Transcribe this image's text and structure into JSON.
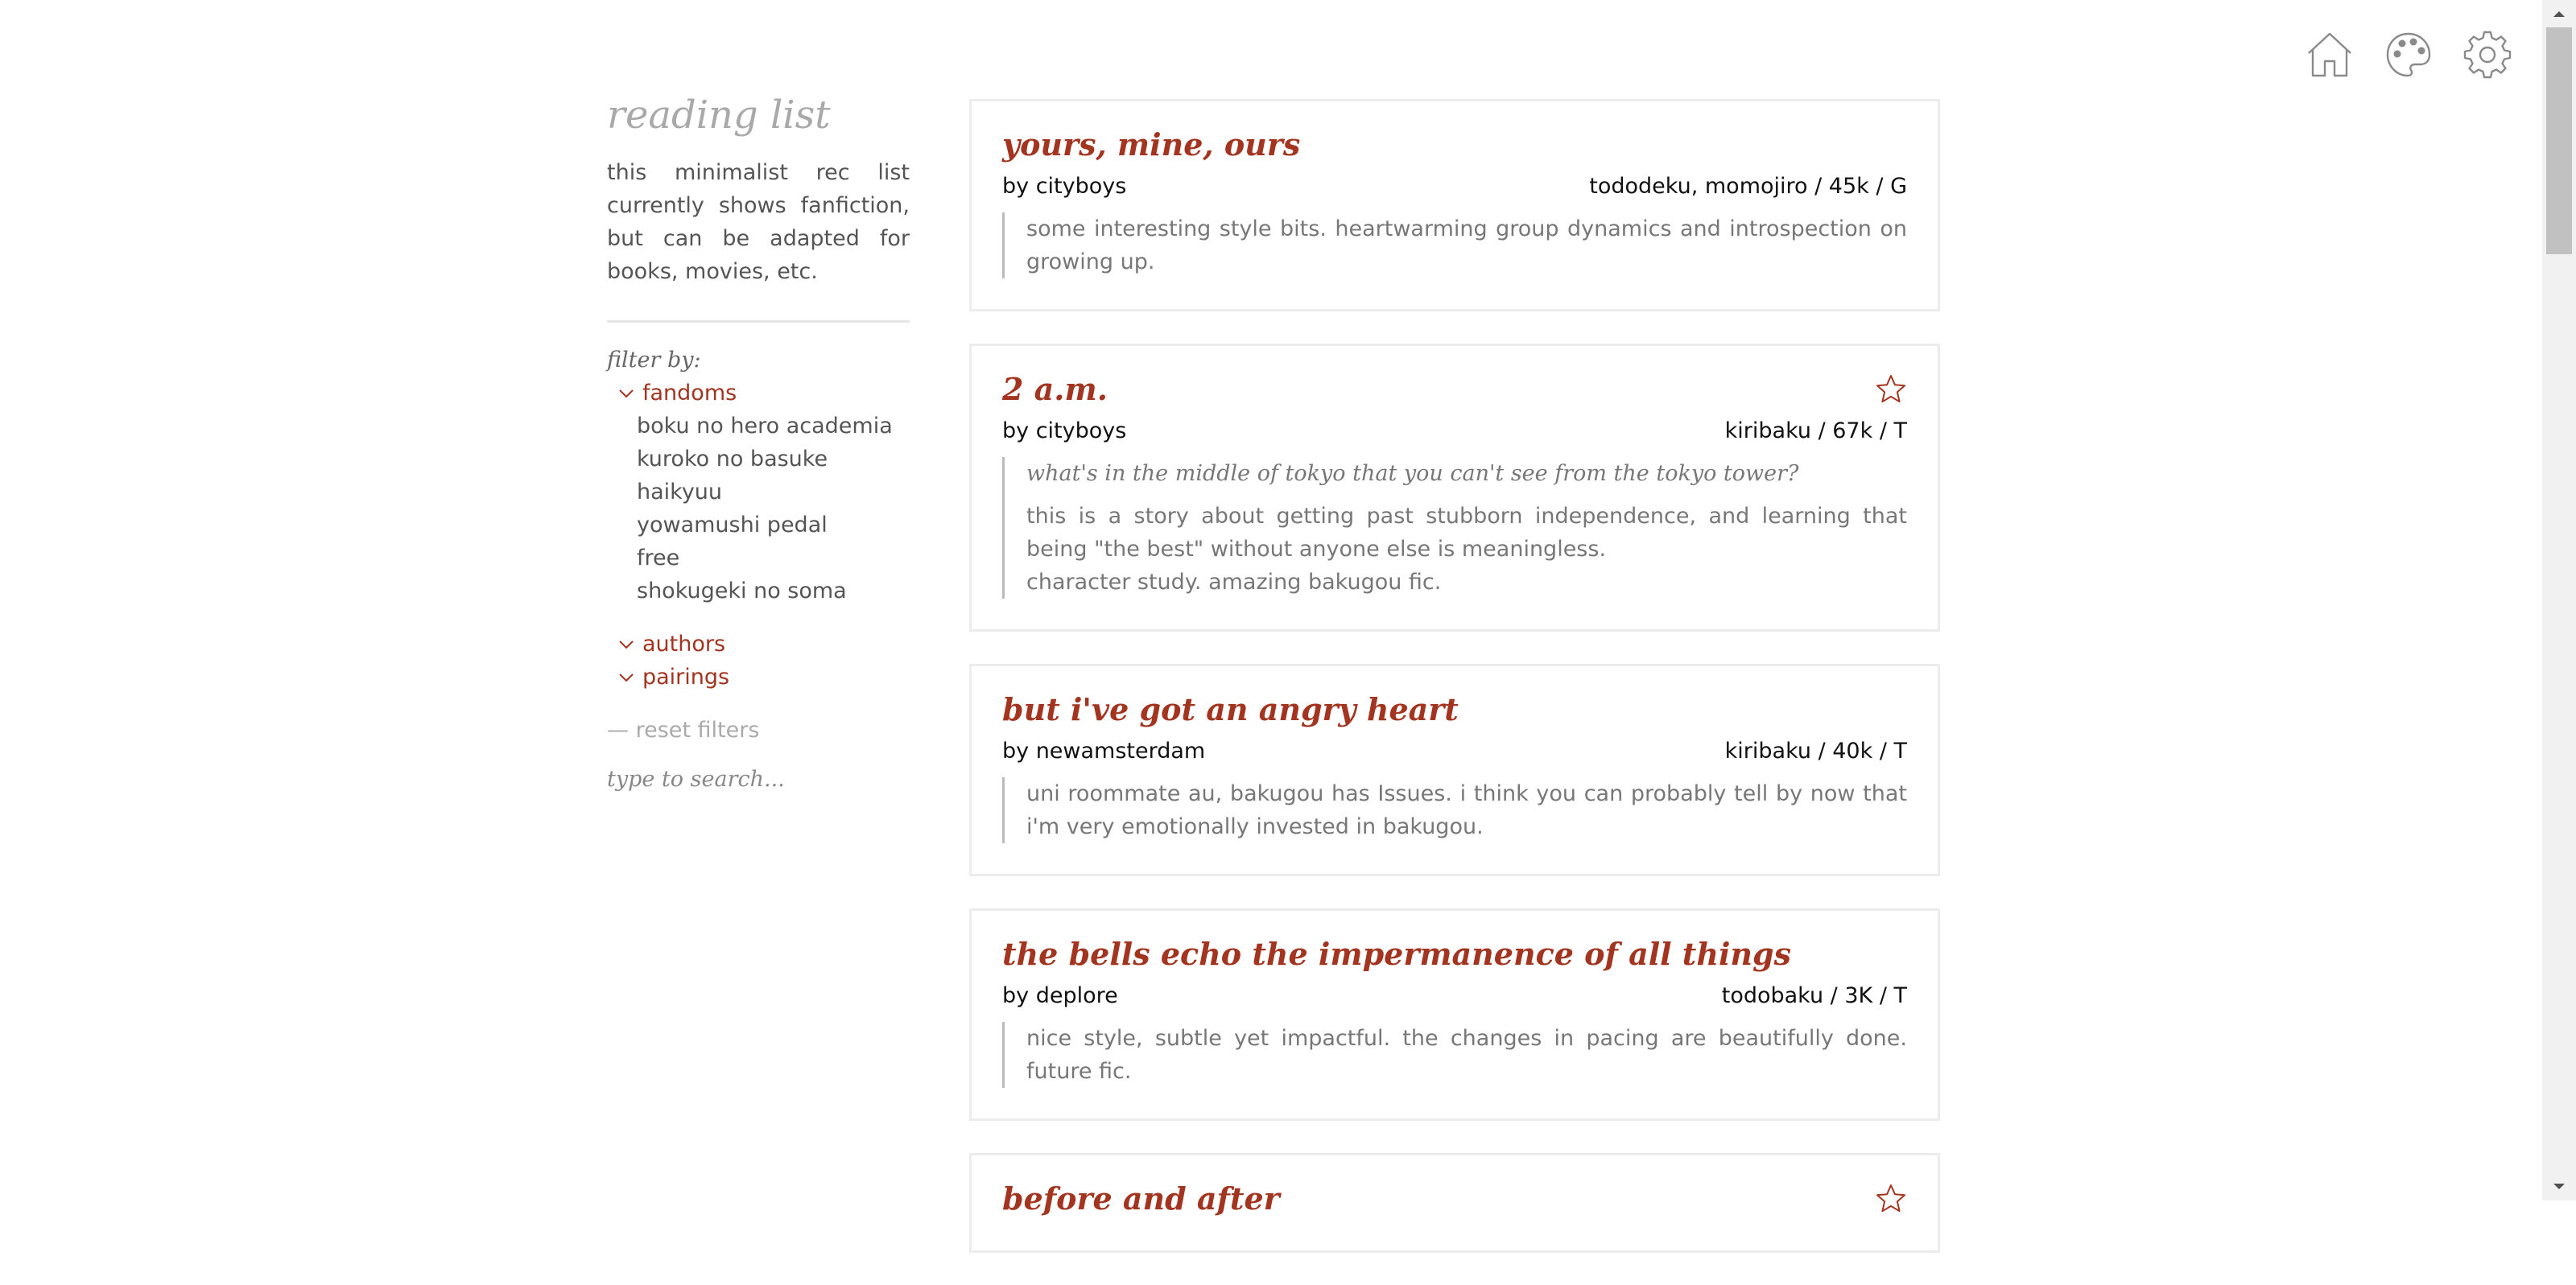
{
  "header_icons": [
    {
      "name": "home-icon"
    },
    {
      "name": "palette-icon"
    },
    {
      "name": "gear-icon"
    }
  ],
  "sidebar": {
    "title": "reading list",
    "intro": "this minimalist rec list currently shows fanfiction, but can be adapted for books, movies, etc.",
    "filter_label": "filter by:",
    "groups": {
      "fandoms": "fandoms",
      "authors": "authors",
      "pairings": "pairings"
    },
    "fandoms": [
      "boku no hero academia",
      "kuroko no basuke",
      "haikyuu",
      "yowamushi pedal",
      "free",
      "shokugeki no soma"
    ],
    "reset": "— reset filters",
    "search_placeholder": "type to search..."
  },
  "cards": [
    {
      "title": "yours, mine, ours",
      "author": "by cityboys",
      "meta": "tododeku, momojiro / 45k / G",
      "starred": false,
      "quote": "",
      "review": [
        "some interesting style bits. heartwarming group dynamics and introspection on growing up."
      ]
    },
    {
      "title": "2 a.m.",
      "author": "by cityboys",
      "meta": "kiribaku / 67k / T",
      "starred": true,
      "quote": "what's in the middle of tokyo that you can't see from the tokyo tower?",
      "review": [
        "this is a story about getting past stubborn independence, and learning that being \"the best\" without anyone else is meaningless.",
        "character study. amazing bakugou fic."
      ]
    },
    {
      "title": "but i've got an angry heart",
      "author": "by newamsterdam",
      "meta": "kiribaku / 40k / T",
      "starred": false,
      "quote": "",
      "review": [
        "uni roommate au, bakugou has Issues. i think you can probably tell by now that i'm very emotionally invested in bakugou."
      ]
    },
    {
      "title": "the bells echo the impermanence of all things",
      "author": "by deplore",
      "meta": "todobaku / 3K / T",
      "starred": false,
      "quote": "",
      "review": [
        "nice style, subtle yet impactful. the changes in pacing are beautifully done. future fic."
      ]
    },
    {
      "title": "before and after",
      "author": "",
      "meta": "",
      "starred": true,
      "quote": "",
      "review": []
    }
  ],
  "colors": {
    "accent": "#a3341f",
    "muted": "#a9a9a9",
    "text": "#555555"
  }
}
